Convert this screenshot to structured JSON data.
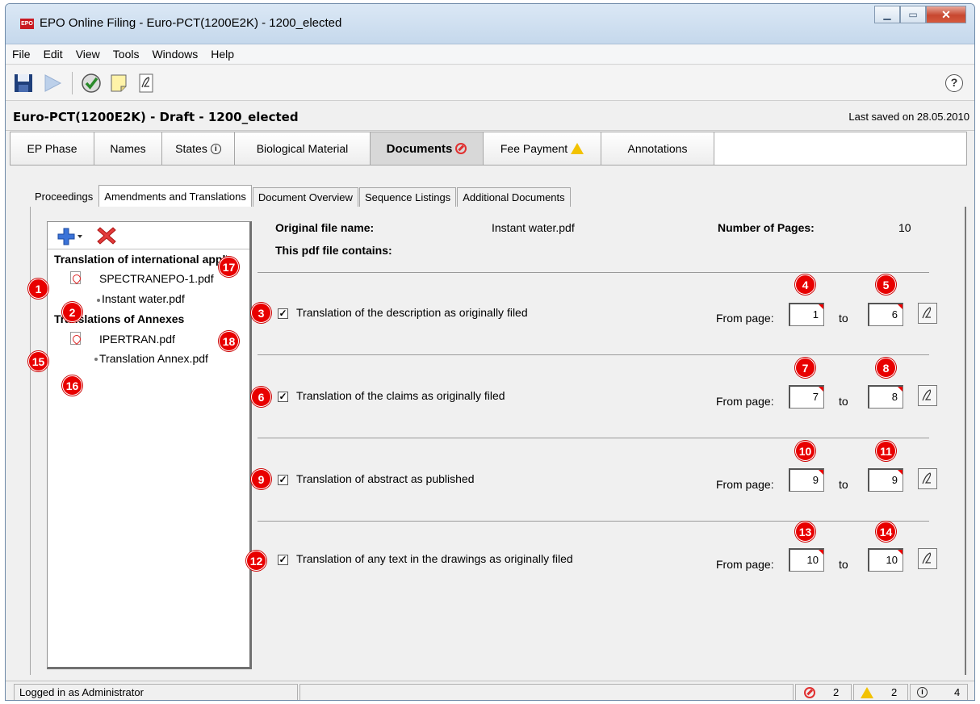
{
  "window": {
    "title": "EPO Online Filing  - Euro-PCT(1200E2K) - 1200_elected",
    "app_icon_text": "EPO"
  },
  "menu": [
    "File",
    "Edit",
    "View",
    "Tools",
    "Windows",
    "Help"
  ],
  "toolbar": {
    "icons": [
      "save-icon",
      "send-icon",
      "validate-icon",
      "note-icon",
      "sign-icon",
      "help-icon"
    ],
    "help_label": "?"
  },
  "doc": {
    "title": "Euro-PCT(1200E2K) - Draft - 1200_elected",
    "last_saved": "Last saved on 28.05.2010"
  },
  "tabs": [
    {
      "label": "EP Phase"
    },
    {
      "label": "Names"
    },
    {
      "label": "States",
      "icon": "info-icon"
    },
    {
      "label": "Biological Material"
    },
    {
      "label": "Documents",
      "icon": "error-icon"
    },
    {
      "label": "Fee Payment",
      "icon": "warning-icon"
    },
    {
      "label": "Annotations"
    }
  ],
  "subtabs": [
    "Proceedings",
    "Amendments and Translations",
    "Document Overview",
    "Sequence Listings",
    "Additional Documents"
  ],
  "tree": {
    "head1": "Translation of international application",
    "item1": "SPECTRANEPO-1.pdf",
    "item1_child": "Instant water.pdf",
    "head2": "Translations of Annexes",
    "item2": "IPERTRAN.pdf",
    "item2_child": "Translation Annex.pdf"
  },
  "details": {
    "orig_label": "Original file name:",
    "orig_value": "Instant water.pdf",
    "pages_label": "Number of Pages:",
    "pages_value": "10",
    "contains_label": "This pdf file contains:",
    "from_label": "From page:",
    "to_label": "to",
    "sections": [
      {
        "label": "Translation of the description as originally filed",
        "checked": true,
        "from": "1",
        "to": "6"
      },
      {
        "label": "Translation of the claims as originally filed",
        "checked": true,
        "from": "7",
        "to": "8"
      },
      {
        "label": "Translation of abstract as published",
        "checked": true,
        "from": "9",
        "to": "9"
      },
      {
        "label": "Translation of any text in the drawings as originally filed",
        "checked": true,
        "from": "10",
        "to": "10"
      }
    ]
  },
  "callouts": [
    "1",
    "2",
    "3",
    "4",
    "5",
    "6",
    "7",
    "8",
    "9",
    "10",
    "11",
    "12",
    "13",
    "14",
    "15",
    "16",
    "17",
    "18"
  ],
  "status": {
    "login": "Logged in as Administrator",
    "errors": "2",
    "warnings": "2",
    "infos": "4"
  },
  "colors": {
    "callout": "#e80000",
    "title_bar": "#c5d8ec",
    "error": "#e03030",
    "warning": "#f2c200"
  }
}
